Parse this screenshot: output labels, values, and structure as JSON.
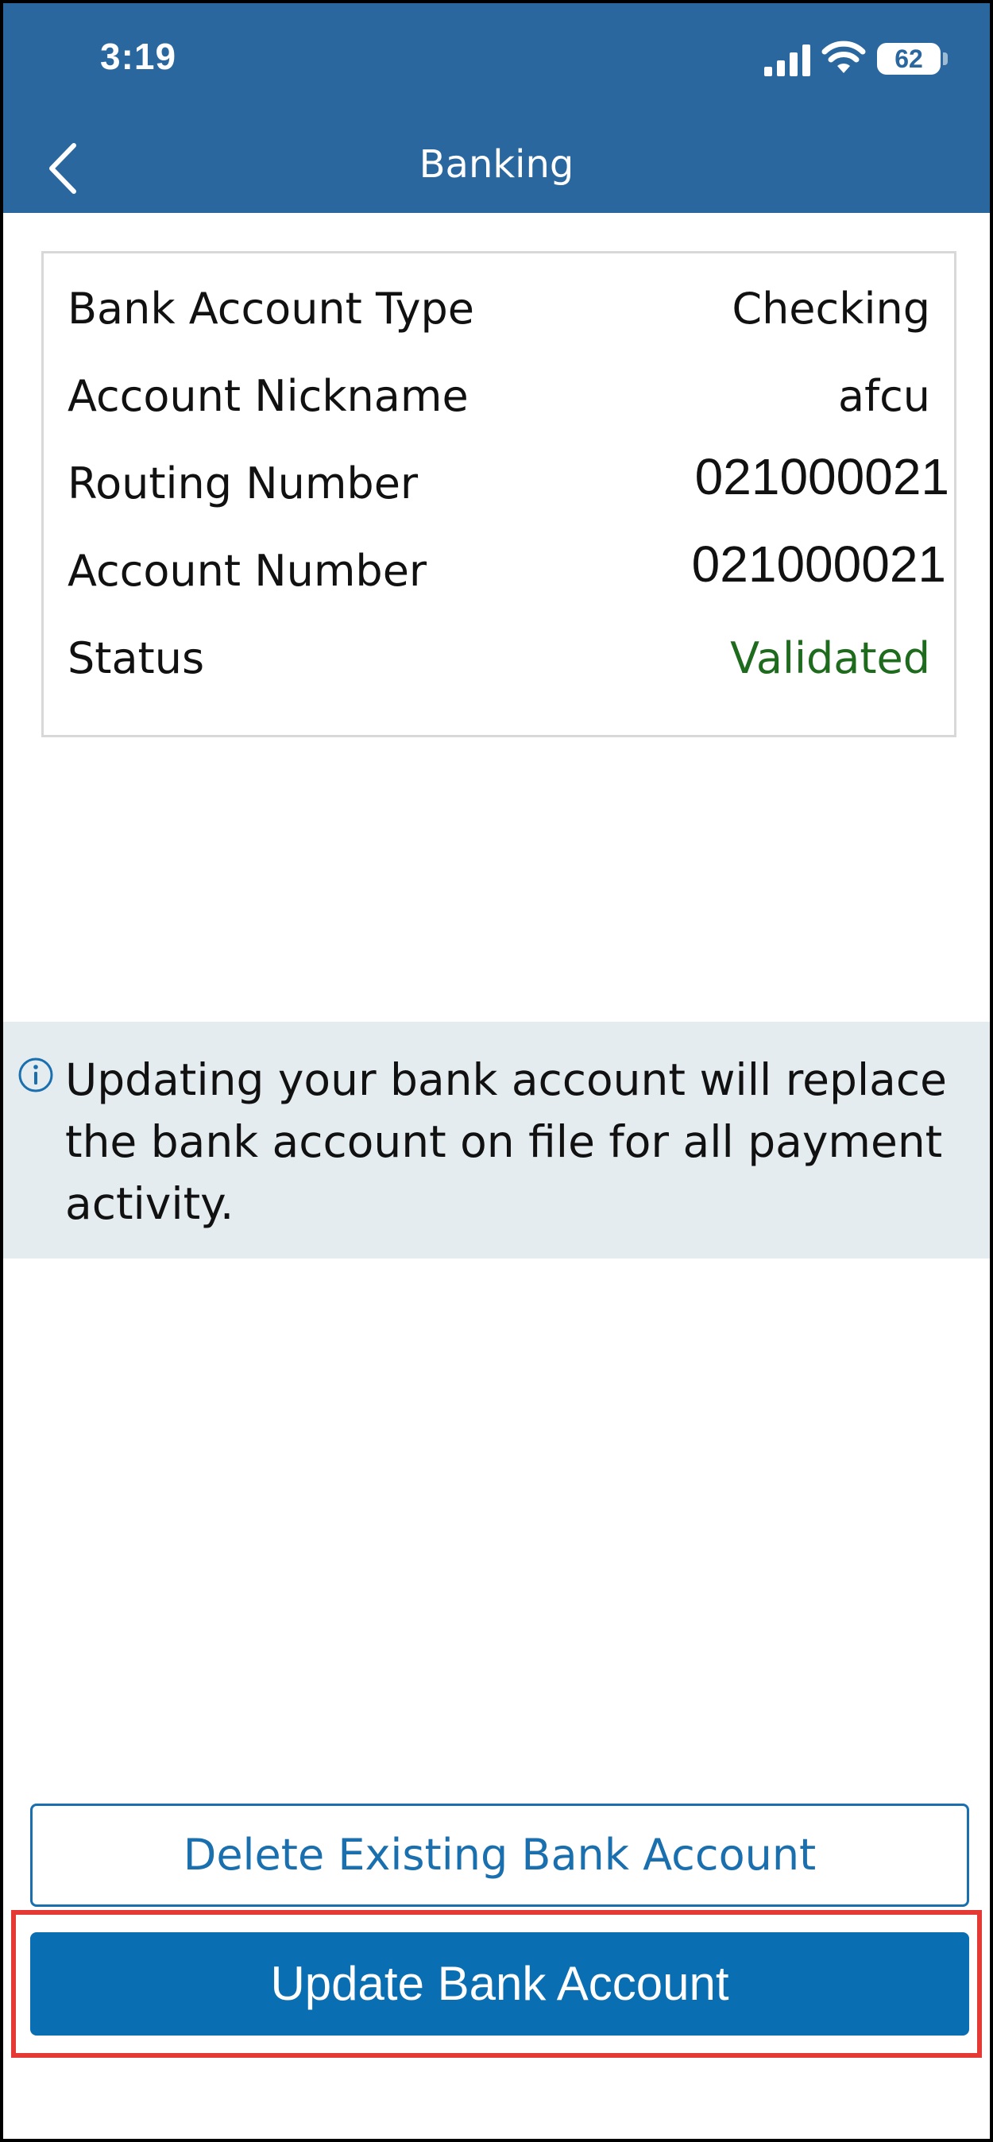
{
  "status_bar": {
    "time": "3:19",
    "battery_level": "62",
    "icons": [
      "signal-icon",
      "wifi-icon",
      "battery-icon"
    ]
  },
  "nav": {
    "title": "Banking",
    "back_icon": "chevron-left-icon"
  },
  "details": {
    "rows": [
      {
        "label": "Bank Account Type",
        "value": "Checking"
      },
      {
        "label": "Account Nickname",
        "value": "afcu"
      },
      {
        "label": "Routing Number",
        "value": "021000021"
      },
      {
        "label": "Account Number",
        "value": "021000021"
      },
      {
        "label": "Status",
        "value": "Validated"
      }
    ]
  },
  "info_banner": {
    "icon": "info-icon",
    "text": "Updating your bank account will replace the bank account on file for all payment activity."
  },
  "actions": {
    "delete_label": "Delete Existing Bank Account",
    "update_label": "Update Bank Account"
  },
  "colors": {
    "header_bg": "#2a679e",
    "accent": "#0a6eb2",
    "status_validated": "#1e6b1e",
    "info_bg": "#e4ecf0",
    "highlight": "#e53935"
  }
}
